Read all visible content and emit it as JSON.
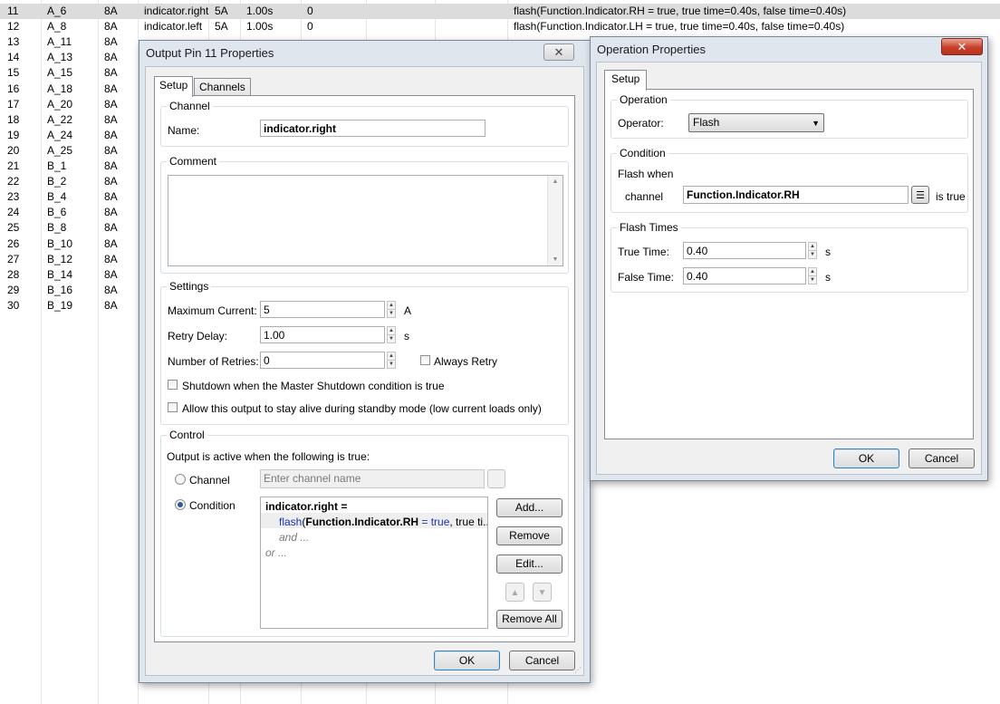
{
  "grid": {
    "rows": [
      {
        "num": "11",
        "pin": "A_6",
        "rating": "8A",
        "name": "indicator.right",
        "current": "5A",
        "delay": "1.00s",
        "retries": "0",
        "expr": "flash(Function.Indicator.RH = true, true time=0.40s, false time=0.40s)",
        "selected": true
      },
      {
        "num": "12",
        "pin": "A_8",
        "rating": "8A",
        "name": "indicator.left",
        "current": "5A",
        "delay": "1.00s",
        "retries": "0",
        "expr": "flash(Function.Indicator.LH = true, true time=0.40s, false time=0.40s)",
        "selected": false
      },
      {
        "num": "13",
        "pin": "A_11",
        "rating": "8A"
      },
      {
        "num": "14",
        "pin": "A_13",
        "rating": "8A"
      },
      {
        "num": "15",
        "pin": "A_15",
        "rating": "8A"
      },
      {
        "num": "16",
        "pin": "A_18",
        "rating": "8A"
      },
      {
        "num": "17",
        "pin": "A_20",
        "rating": "8A"
      },
      {
        "num": "18",
        "pin": "A_22",
        "rating": "8A"
      },
      {
        "num": "19",
        "pin": "A_24",
        "rating": "8A"
      },
      {
        "num": "20",
        "pin": "A_25",
        "rating": "8A"
      },
      {
        "num": "21",
        "pin": "B_1",
        "rating": "8A"
      },
      {
        "num": "22",
        "pin": "B_2",
        "rating": "8A"
      },
      {
        "num": "23",
        "pin": "B_4",
        "rating": "8A"
      },
      {
        "num": "24",
        "pin": "B_6",
        "rating": "8A"
      },
      {
        "num": "25",
        "pin": "B_8",
        "rating": "8A"
      },
      {
        "num": "26",
        "pin": "B_10",
        "rating": "8A"
      },
      {
        "num": "27",
        "pin": "B_12",
        "rating": "8A"
      },
      {
        "num": "28",
        "pin": "B_14",
        "rating": "8A"
      },
      {
        "num": "29",
        "pin": "B_16",
        "rating": "8A"
      },
      {
        "num": "30",
        "pin": "B_19",
        "rating": "8A"
      }
    ]
  },
  "output_dialog": {
    "title": "Output Pin 11 Properties",
    "close": "✕",
    "tabs": [
      "Setup",
      "Channels"
    ],
    "channel_group": "Channel",
    "name_label": "Name:",
    "name_value": "indicator.right",
    "comment_group": "Comment",
    "settings_group": "Settings",
    "max_current_label": "Maximum Current:",
    "max_current_value": "5",
    "max_current_unit": "A",
    "retry_delay_label": "Retry Delay:",
    "retry_delay_value": "1.00",
    "retry_delay_unit": "s",
    "retries_label": "Number of Retries:",
    "retries_value": "0",
    "always_retry": "Always Retry",
    "shutdown_check": "Shutdown when the Master Shutdown condition is true",
    "standby_check": "Allow this output to stay alive during standby mode (low current loads only)",
    "control_group": "Control",
    "active_when": "Output is active when the following is true:",
    "radio_channel": "Channel",
    "channel_placeholder": "Enter channel name",
    "radio_condition": "Condition",
    "cond_head": "indicator.right =",
    "cond_fn": "flash",
    "cond_open": "(",
    "cond_arg": "Function.Indicator.RH",
    "cond_eq": " = true",
    "cond_rest": ", true ti...",
    "cond_and": "and ...",
    "cond_or": "or ...",
    "add": "Add...",
    "remove": "Remove",
    "edit": "Edit...",
    "remove_all": "Remove All",
    "ok": "OK",
    "cancel": "Cancel"
  },
  "op_dialog": {
    "title": "Operation Properties",
    "close": "✕",
    "tab": "Setup",
    "operation_group": "Operation",
    "operator_label": "Operator:",
    "operator_value": "Flash",
    "condition_group": "Condition",
    "flash_when": "Flash when",
    "channel_label": "channel",
    "channel_value": "Function.Indicator.RH",
    "is_true": "is true",
    "flash_times_group": "Flash Times",
    "true_time_label": "True Time:",
    "true_time_value": "0.40",
    "false_time_label": "False Time:",
    "false_time_value": "0.40",
    "unit": "s",
    "ok": "OK",
    "cancel": "Cancel"
  }
}
